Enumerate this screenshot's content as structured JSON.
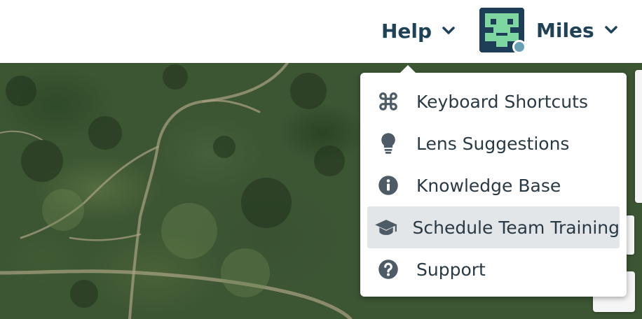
{
  "header": {
    "help_label": "Help",
    "user": {
      "name": "Miles",
      "avatar_bg": "#1e3e58",
      "avatar_fg": "#7ed6a0",
      "status_color": "#6a9fb8"
    }
  },
  "help_menu": {
    "items": [
      {
        "label": "Keyboard Shortcuts",
        "icon": "command-icon",
        "active": false
      },
      {
        "label": "Lens Suggestions",
        "icon": "lightbulb-icon",
        "active": false
      },
      {
        "label": "Knowledge Base",
        "icon": "info-circle-icon",
        "active": false
      },
      {
        "label": "Schedule Team Training",
        "icon": "graduation-cap-icon",
        "active": true
      },
      {
        "label": "Support",
        "icon": "question-circle-icon",
        "active": false
      }
    ]
  },
  "colors": {
    "text_primary": "#1f4257",
    "menu_text": "#2a3a45",
    "menu_icon": "#4d5b66",
    "menu_active_bg": "#e3e6e9"
  }
}
